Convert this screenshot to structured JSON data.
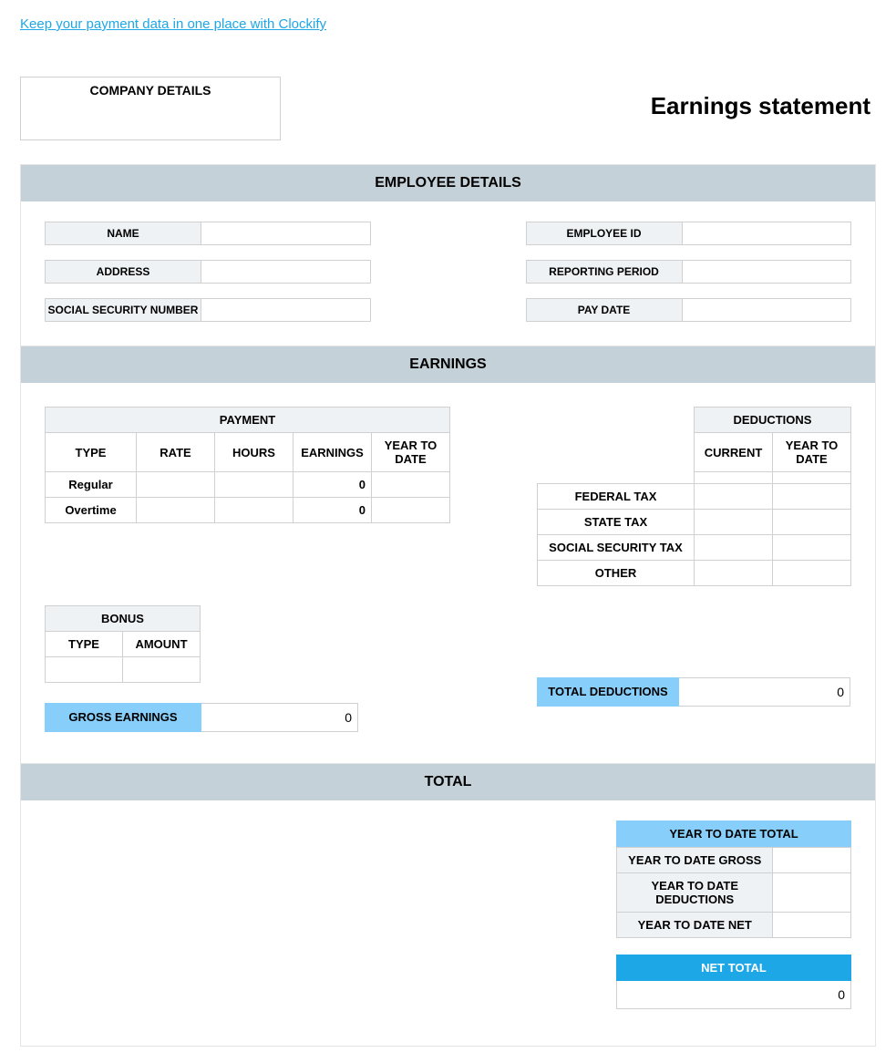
{
  "promo_link": "Keep your payment data in one place with Clockify",
  "company_box_label": "COMPANY DETAILS",
  "page_title": "Earnings statement",
  "employee_section": {
    "header": "EMPLOYEE DETAILS",
    "left": {
      "name": "NAME",
      "address": "ADDRESS",
      "ssn": "SOCIAL SECURITY NUMBER"
    },
    "right": {
      "emp_id": "EMPLOYEE ID",
      "period": "REPORTING PERIOD",
      "pay_date": "PAY DATE"
    }
  },
  "earnings_section": {
    "header": "EARNINGS",
    "payment_header": "PAYMENT",
    "cols": {
      "type": "TYPE",
      "rate": "RATE",
      "hours": "HOURS",
      "earnings": "EARNINGS",
      "ytd": "YEAR TO DATE"
    },
    "rows": [
      {
        "type": "Regular",
        "rate": "",
        "hours": "",
        "earnings": "0",
        "ytd": ""
      },
      {
        "type": "Overtime",
        "rate": "",
        "hours": "",
        "earnings": "0",
        "ytd": ""
      }
    ],
    "deductions_header": "DEDUCTIONS",
    "deduct_cols": {
      "current": "CURRENT",
      "ytd": "YEAR TO DATE"
    },
    "deduct_rows": [
      {
        "label": "",
        "current": "",
        "ytd": ""
      },
      {
        "label": "FEDERAL TAX",
        "current": "",
        "ytd": ""
      },
      {
        "label": "STATE TAX",
        "current": "",
        "ytd": ""
      },
      {
        "label": "SOCIAL SECURITY TAX",
        "current": "",
        "ytd": ""
      },
      {
        "label": "OTHER",
        "current": "",
        "ytd": ""
      }
    ],
    "bonus_header": "BONUS",
    "bonus_cols": {
      "type": "TYPE",
      "amount": "AMOUNT"
    },
    "gross_label": "GROSS EARNINGS",
    "gross_value": "0",
    "total_ded_label": "TOTAL DEDUCTIONS",
    "total_ded_value": "0"
  },
  "total_section": {
    "header": "TOTAL",
    "ytd_header": "YEAR TO DATE TOTAL",
    "ytd_gross": "YEAR TO DATE GROSS",
    "ytd_ded": "YEAR TO DATE DEDUCTIONS",
    "ytd_net": "YEAR TO DATE NET",
    "net_header": "NET TOTAL",
    "net_value": "0"
  }
}
